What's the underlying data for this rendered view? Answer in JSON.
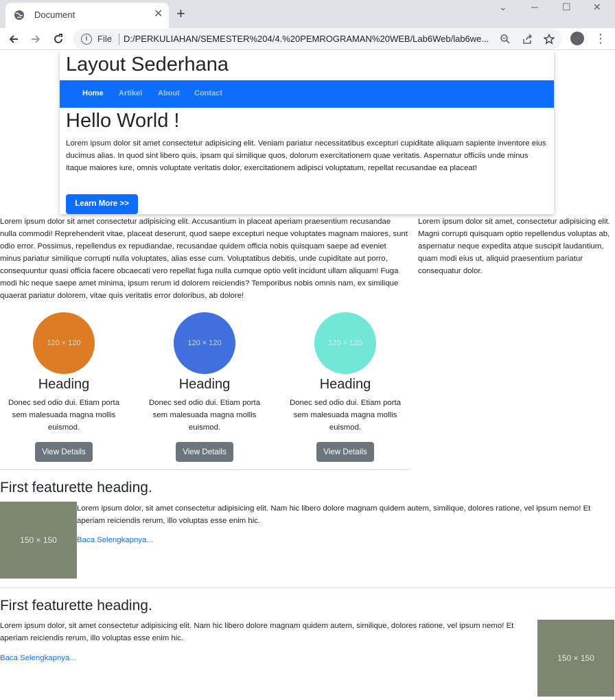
{
  "browser": {
    "tab_title": "Document",
    "close_glyph": "✕",
    "newtab_glyph": "+",
    "file_label": "File",
    "url": "D:/PERKULIAHAN/SEMESTER%204/4.%20PEMROGRAMAN%20WEB/Lab6Web/lab6we...",
    "window_controls": {
      "dropdown": "⌄",
      "minimize": "─",
      "maximize": "☐",
      "close": "✕"
    },
    "menu_glyph": "⋮"
  },
  "site": {
    "title": "Layout Sederhana",
    "nav": [
      {
        "label": "Home",
        "active": true
      },
      {
        "label": "Artikel",
        "active": false
      },
      {
        "label": "About",
        "active": false
      },
      {
        "label": "Contact",
        "active": false
      }
    ],
    "hero": {
      "title": "Hello World !",
      "text": "Lorem ipsum dolor sit amet consectetur adipisicing elit. Veniam pariatur necessitatibus excepturi cupiditate aliquam sapiente inventore eius ducimus alias. In quod sint libero quis, ipsam qui similique quos, dolorum exercitationem quae veritatis. Aspernatur officiis unde minus itaque maiores iure, omnis voluptate veritatis dolor, exercitationem adipisci voluptatum, repellat recusandae ea placeat!",
      "button": "Learn More >>"
    },
    "main_text": "Lorem ipsum dolor sit amet consectetur adipisicing elit. Accusantium in placeat aperiam praesentium recusandae nulla commodi! Reprehenderit vitae, placeat deserunt, quod saepe excepturi neque voluptates magnam maiores, sunt odio error. Possimus, repellendus ex repudiandae, recusandae quidem officia nobis quisquam saepe ad eveniet minus pariatur similique corrupti nulla voluptates, alias esse cum. Voluptatibus debitis, unde cupiditate aut porro, consequuntur quasi officia facere obcaecati vero repellat fuga nulla cumque optio velit incidunt ullam aliquam! Fuga modi hic neque saepe amet minima, ipsum rerum id dolorem reiciendis? Temporibus nobis omnis nam, ex similique quaerat pariatur dolorem, vitae quis veritatis error doloribus, ab dolore!",
    "aside_text": "Lorem ipsum dolor sit amet, consectetur adipisicing elit. Magni corrupti quisquam optio repellendus voluptas ab, aspernatur neque expedita atque suscipit laudantium, quam modi eius ut, aliquid praesentium pariatur consequatur dolor.",
    "columns": [
      {
        "placeholder": "120 × 120",
        "color": "#dd7c25",
        "heading": "Heading",
        "text": "Donec sed odio dui. Etiam porta sem malesuada magna mollis euismod.",
        "button": "View Details"
      },
      {
        "placeholder": "120 × 120",
        "color": "#4070e0",
        "heading": "Heading",
        "text": "Donec sed odio dui. Etiam porta sem malesuada magna mollis euismod.",
        "button": "View Details"
      },
      {
        "placeholder": "120 × 120",
        "color": "#72e6d7",
        "heading": "Heading",
        "text": "Donec sed odio dui. Etiam porta sem malesuada magna mollis euismod.",
        "button": "View Details"
      }
    ],
    "featurettes": [
      {
        "heading": "First featurette heading.",
        "text": "Lorem ipsum dolor, sit amet consectetur adipisicing elit. Nam hic libero dolore magnam quidem autem, similique, dolores ratione, vel ipsum nemo! Et aperiam reiciendis rerum, illo voluptas esse enim hic.",
        "link": "Baca Selengkapnya...",
        "image": "150 × 150"
      },
      {
        "heading": "First featurette heading.",
        "text": "Lorem ipsum dolor, sit amet consectetur adipisicing elit. Nam hic libero dolore magnam quidem autem, similique, dolores ratione, vel ipsum nemo! Et aperiam reiciendis rerum, illo voluptas esse enim hic.",
        "link": "Baca Selengkapnya...",
        "image": "150 × 150"
      }
    ]
  },
  "colors": {
    "primary": "#0d6efd",
    "secondary": "#6c757d",
    "placeholder_gray": "#7c8670"
  },
  "icons": [
    "globe-icon",
    "close-icon",
    "plus-icon",
    "back-arrow-icon",
    "forward-arrow-icon",
    "reload-icon",
    "info-icon",
    "zoom-icon",
    "share-icon",
    "star-icon",
    "profile-icon",
    "menu-dots-icon"
  ]
}
